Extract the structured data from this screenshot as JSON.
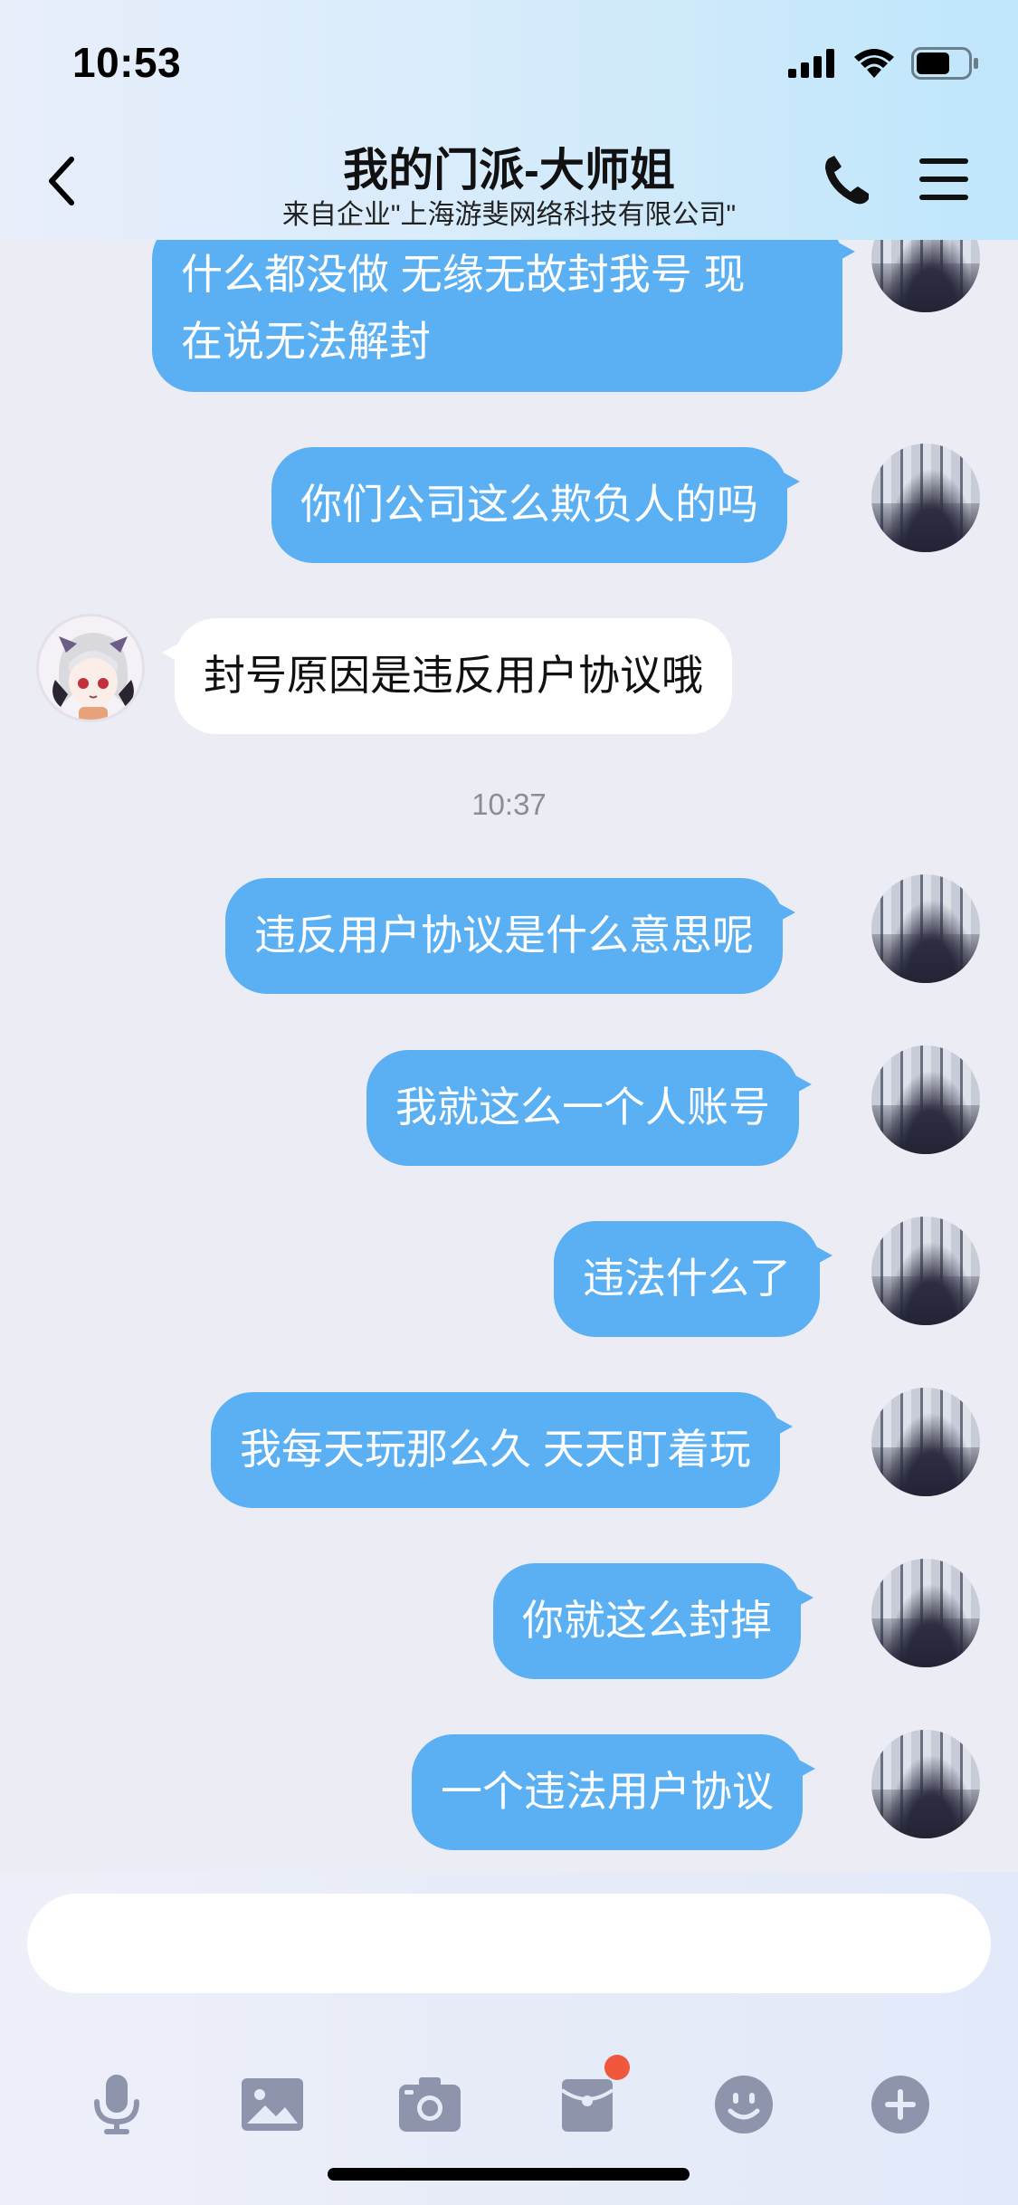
{
  "status_bar": {
    "time": "10:53"
  },
  "header": {
    "title": "我的门派-大师姐",
    "subtitle": "来自企业\"上海游斐网络科技有限公司\""
  },
  "messages": [
    {
      "from": "me",
      "lines": [
        "什么都没做 无缘无故封我号 现",
        "在说无法解封"
      ]
    },
    {
      "from": "me",
      "text": "你们公司这么欺负人的吗"
    },
    {
      "from": "other",
      "text": "封号原因是违反用户协议哦"
    },
    {
      "from": "me",
      "text": "违反用户协议是什么意思呢"
    },
    {
      "from": "me",
      "text": "我就这么一个人账号"
    },
    {
      "from": "me",
      "text": "违法什么了"
    },
    {
      "from": "me",
      "text": "我每天玩那么久 天天盯着玩"
    },
    {
      "from": "me",
      "text": "你就这么封掉"
    },
    {
      "from": "me",
      "text": "一个违法用户协议"
    }
  ],
  "timestamp": "10:37",
  "input": {
    "placeholder": ""
  },
  "toolbar": {
    "icons": [
      "microphone-icon",
      "image-icon",
      "camera-icon",
      "red-packet-icon",
      "emoji-icon",
      "plus-icon"
    ],
    "icon_color": "#8e94ab",
    "badge_color": "#f0583e"
  },
  "colors": {
    "my_bubble": "#5ab0f3",
    "other_bubble": "#ffffff",
    "background": "#ececf4"
  }
}
